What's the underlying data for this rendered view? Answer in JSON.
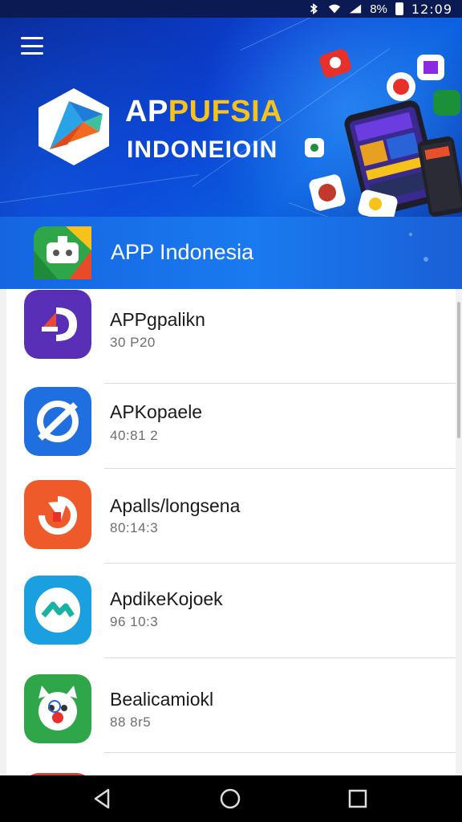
{
  "status_bar": {
    "battery": "8%",
    "time": "12:09"
  },
  "hero": {
    "title_part1": "AP",
    "title_part2": "PUFSIA",
    "subtitle": "INDONEIOIN"
  },
  "section": {
    "title": "APP Indonesia"
  },
  "apps": [
    {
      "name": "APPgpalikn",
      "meta": "30 P20"
    },
    {
      "name": "APKopaele",
      "meta": "40:81 2"
    },
    {
      "name": "Apalls/longsena",
      "meta": "80:14:3"
    },
    {
      "name": "ApdikeKojoek",
      "meta": "96 10:3"
    },
    {
      "name": "Bealicamiokl",
      "meta": "88 8r5"
    }
  ],
  "colors": {
    "hero_blue": "#0b3fd0",
    "section_blue": "#1a7af0",
    "accent_yellow": "#f7c21a"
  },
  "icons": {
    "menu": "hamburger-icon",
    "back": "back-triangle-icon",
    "home": "home-circle-icon",
    "recents": "recents-square-icon"
  }
}
